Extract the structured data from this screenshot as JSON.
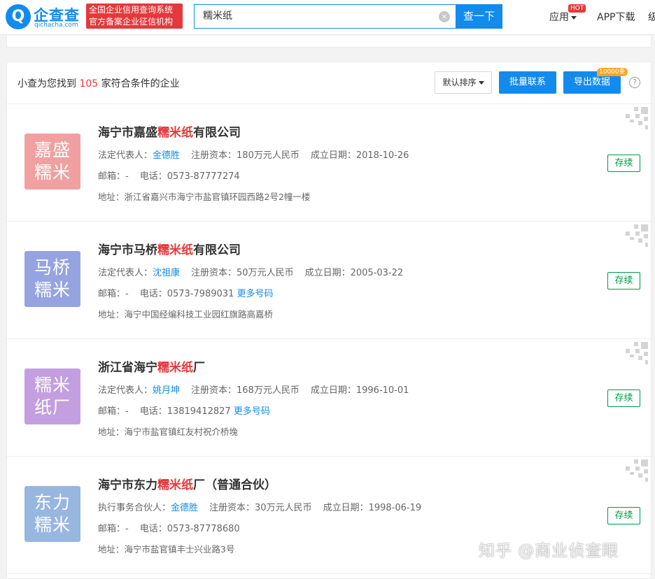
{
  "header": {
    "logo_glyph": "Q",
    "logo_name": "企查查",
    "logo_domain": "qichacha.com",
    "badge_line1": "全国企业信用查询系统",
    "badge_line2": "官方备案企业征信机构",
    "search_value": "糯米纸",
    "clear_glyph": "×",
    "search_button": "查一下",
    "nav_app": "应用",
    "nav_hot": "HOT",
    "nav_download": "APP下载",
    "nav_more": "级"
  },
  "toolbar": {
    "result_prefix": "小查为您找到 ",
    "result_count": "105",
    "result_suffix": " 家符合条件的企业",
    "sort_label": "默认排序",
    "bulk_label": "批量联系",
    "export_label": "导出数据",
    "export_badge": "10000条",
    "help_glyph": "?"
  },
  "companies": [
    {
      "avatar_line1": "嘉盛",
      "avatar_line2": "糯米",
      "avatar_color": "#f0a0a0",
      "name_prefix": "海宁市嘉盛",
      "name_highlight": "糯米纸",
      "name_suffix": "有限公司",
      "rep_label": "法定代表人：",
      "rep": "金德胜",
      "capital": "注册资本：180万元人民币",
      "date": "成立日期：2018-10-26",
      "email": "邮箱：-",
      "phone": "电话：0573-87777274",
      "more_phones": "",
      "address": "地址：浙江省嘉兴市海宁市盐官镇环园西路2号2幢一楼",
      "status": "存续"
    },
    {
      "avatar_line1": "马桥",
      "avatar_line2": "糯米",
      "avatar_color": "#95a4e0",
      "name_prefix": "海宁市马桥",
      "name_highlight": "糯米纸",
      "name_suffix": "有限公司",
      "rep_label": "法定代表人：",
      "rep": "沈祖康",
      "capital": "注册资本：50万元人民币",
      "date": "成立日期：2005-03-22",
      "email": "邮箱：-",
      "phone": "电话：0573-7989031",
      "more_phones": "更多号码",
      "address": "地址：海宁中国经编科技工业园红旗路高嘉桥",
      "status": "存续"
    },
    {
      "avatar_line1": "糯米",
      "avatar_line2": "纸厂",
      "avatar_color": "#c39ee0",
      "name_prefix": "浙江省海宁",
      "name_highlight": "糯米纸",
      "name_suffix": "厂",
      "rep_label": "法定代表人：",
      "rep": "姚月坤",
      "capital": "注册资本：168万元人民币",
      "date": "成立日期：1996-10-01",
      "email": "邮箱：-",
      "phone": "电话：13819412827",
      "more_phones": "更多号码",
      "address": "地址：海宁市盐官镇红友村祝介桥堍",
      "status": "存续"
    },
    {
      "avatar_line1": "东力",
      "avatar_line2": "糯米",
      "avatar_color": "#97b6e0",
      "name_prefix": "海宁市东力",
      "name_highlight": "糯米纸",
      "name_suffix": "厂（普通合伙）",
      "rep_label": "执行事务合伙人：",
      "rep": "金德胜",
      "capital": "注册资本：30万元人民币",
      "date": "成立日期：1998-06-19",
      "email": "邮箱：-",
      "phone": "电话：0573-87778680",
      "more_phones": "",
      "address": "地址：海宁市盐官镇丰士兴业路3号",
      "status": "存续"
    }
  ],
  "watermark": "知乎 @商业侦查眼"
}
